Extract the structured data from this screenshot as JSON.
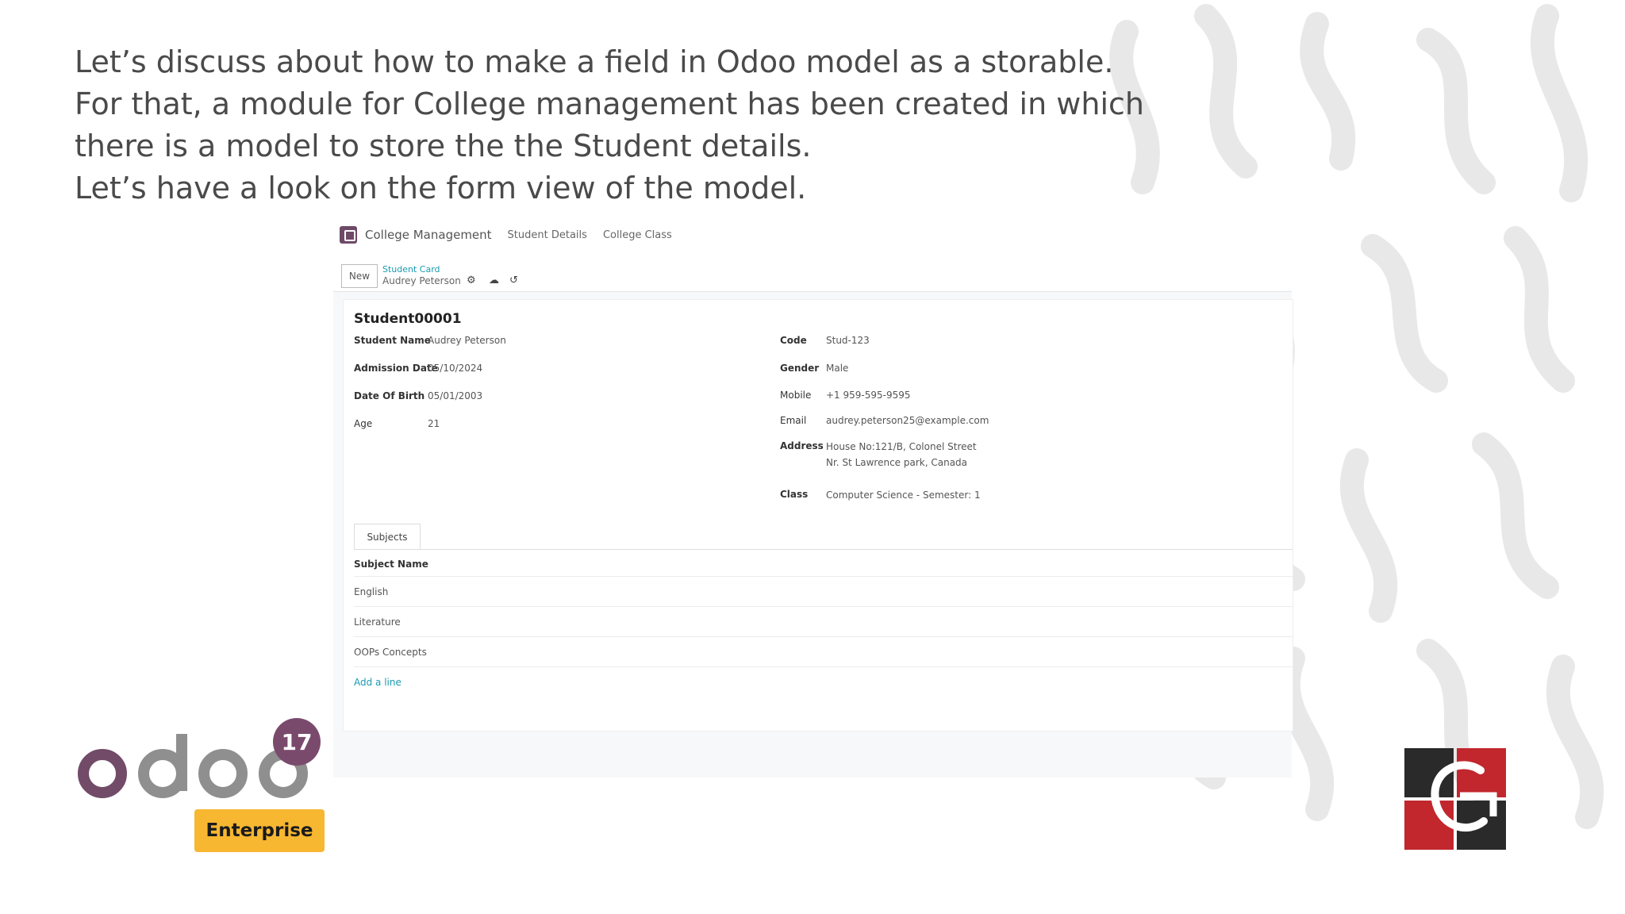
{
  "intro": {
    "line1": "Let’s discuss about how to make a field in Odoo model as a  storable.",
    "line2": "For that, a module for College management has been created in which",
    "line3": "there is a model to store the the Student details.",
    "line4": "Let’s have a look on the form view of the model."
  },
  "app": {
    "menu_title": "College Management",
    "menu_items": [
      "Student Details",
      "College Class"
    ],
    "new_label": "New",
    "breadcrumb": "Student Card",
    "record_name": "Audrey Peterson"
  },
  "form": {
    "reference": "Student00001",
    "left_fields": [
      {
        "label": "Student Name",
        "value": "Audrey Peterson"
      },
      {
        "label": "Admission Date",
        "value": "05/10/2024"
      },
      {
        "label": "Date Of Birth",
        "value": "05/01/2003"
      },
      {
        "label": "Age",
        "value": "21"
      }
    ],
    "right_fields": [
      {
        "label": "Code",
        "value": "Stud-123"
      },
      {
        "label": "Gender",
        "value": "Male"
      },
      {
        "label": "Mobile",
        "value": "+1 959-595-9595"
      },
      {
        "label": "Email",
        "value": "audrey.peterson25@example.com"
      },
      {
        "label": "Address",
        "value": "House No:121/B, Colonel Street",
        "value2": "Nr. St Lawrence park, Canada"
      },
      {
        "label": "Class",
        "value": "Computer Science - Semester: 1"
      }
    ],
    "tab_label": "Subjects",
    "column_header": "Subject Name",
    "subjects": [
      "English",
      "Literature",
      "OOPs Concepts"
    ],
    "add_line_label": "Add a line"
  },
  "branding": {
    "odoo_wordmark": "odoo",
    "version": "17",
    "edition": "Enterprise",
    "colors": {
      "odoo_purple": "#714B67",
      "odoo_grey": "#8f8f8f",
      "enterprise": "#f7b731",
      "red": "#c1272d"
    }
  }
}
